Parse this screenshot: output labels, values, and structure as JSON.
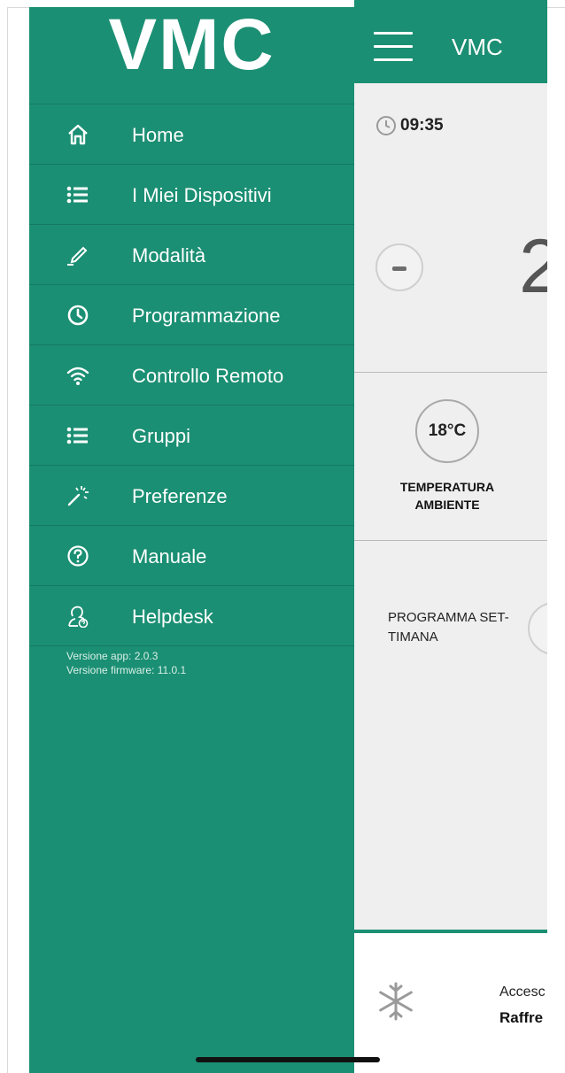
{
  "header": {
    "title": "VMC"
  },
  "drawer": {
    "logo": "VMC",
    "items": [
      {
        "label": "Home",
        "icon": "home-icon"
      },
      {
        "label": "I Miei Dispositivi",
        "icon": "list-icon"
      },
      {
        "label": "Modalità",
        "icon": "pencil-icon"
      },
      {
        "label": "Programmazione",
        "icon": "clock-icon"
      },
      {
        "label": "Controllo Remoto",
        "icon": "wifi-icon"
      },
      {
        "label": "Gruppi",
        "icon": "list-icon"
      },
      {
        "label": "Preferenze",
        "icon": "magic-wand-icon"
      },
      {
        "label": "Manuale",
        "icon": "help-icon"
      },
      {
        "label": "Helpdesk",
        "icon": "helpdesk-icon"
      }
    ],
    "version_app": "Versione app: 2.0.3",
    "version_fw": "Versione firmware: 11.0.1"
  },
  "main": {
    "time": "09:35",
    "setpoint_partial": "2",
    "room_temp": "18°C",
    "room_temp_label_1": "TEMPERATURA",
    "room_temp_label_2": "AMBIENTE",
    "program_label_1": "PROGRAMMA SET-",
    "program_label_2": "TIMANA",
    "status_1": "Accesc",
    "status_2": "Raffre"
  },
  "colors": {
    "accent": "#1b8f73",
    "panel": "#efefef"
  }
}
